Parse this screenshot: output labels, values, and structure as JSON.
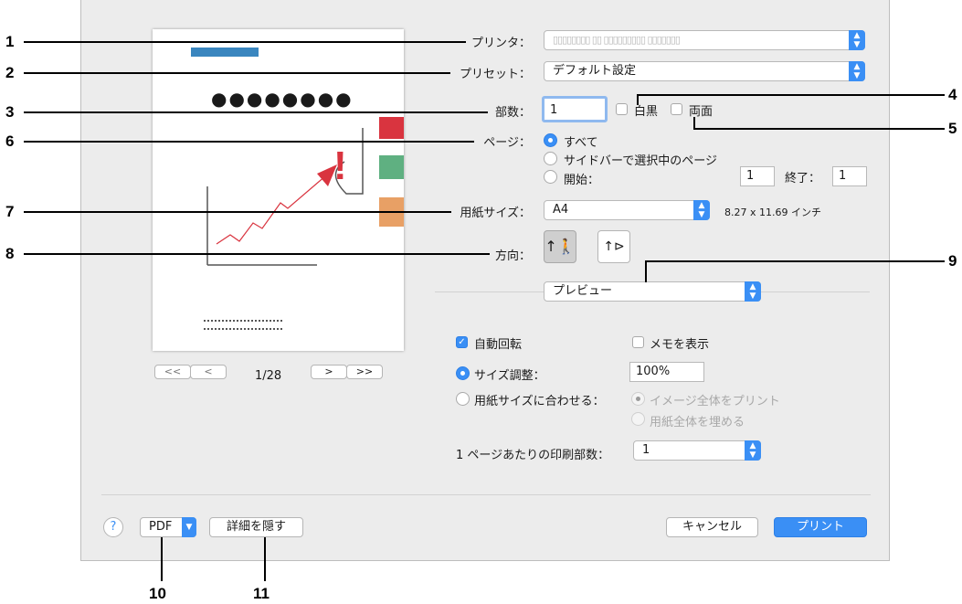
{
  "printer": {
    "label": "プリンタ：",
    "value": "▯▯▯▯▯▯▯▯ ▯▯ ▯▯▯▯▯▯▯▯▯ ▯▯▯▯▯▯▯"
  },
  "preset": {
    "label": "プリセット：",
    "value": "デフォルト設定"
  },
  "copies": {
    "label": "部数：",
    "value": "1",
    "bw_label": "白黒",
    "duplex_label": "両面"
  },
  "pages": {
    "label": "ページ：",
    "all": "すべて",
    "selected": "サイドバーで選択中のページ",
    "from_label": "開始：",
    "from_value": "1",
    "to_label": "終了：",
    "to_value": "1"
  },
  "paper": {
    "label": "用紙サイズ：",
    "value": "A4",
    "dimensions": "8.27 x 11.69 インチ"
  },
  "orientation": {
    "label": "方向："
  },
  "section_popup": {
    "value": "プレビュー"
  },
  "options": {
    "auto_rotate": "自動回転",
    "show_notes": "メモを表示",
    "scale_label": "サイズ調整：",
    "scale_value": "100%",
    "fit_label": "用紙サイズに合わせる：",
    "fit_entire": "イメージ全体をプリント",
    "fit_fill": "用紙全体を埋める",
    "per_page_label": "1 ページあたりの印刷部数：",
    "per_page_value": "1"
  },
  "preview": {
    "page_counter": "1/28",
    "first_btn": "<<",
    "prev_btn": "<",
    "next_btn": ">",
    "last_btn": ">>"
  },
  "footer": {
    "help": "?",
    "pdf": "PDF",
    "hide_details": "詳細を隠す",
    "cancel": "キャンセル",
    "print": "プリント"
  },
  "callouts": [
    "1",
    "2",
    "3",
    "4",
    "5",
    "6",
    "7",
    "8",
    "9",
    "10",
    "11"
  ],
  "colors": {
    "accent": "#3a8ff5",
    "dialog_bg": "#ececec"
  }
}
